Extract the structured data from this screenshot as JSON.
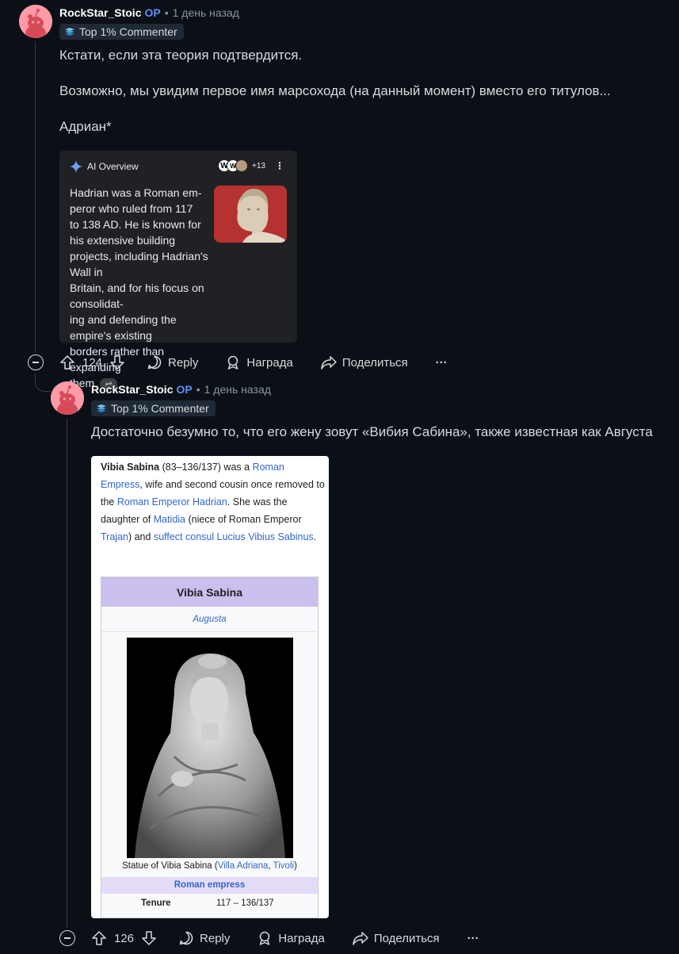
{
  "comments": [
    {
      "username": "RockStar_Stoic",
      "op_label": "OP",
      "separator": "•",
      "time": "1 день назад",
      "flair": "Top 1% Commenter",
      "body": [
        "Кстати, если эта теория подтвердится.",
        "Возможно, мы увидим первое имя марсохода (на данный момент) вместо его титулов...",
        "Адриан*"
      ],
      "attachment": {
        "type": "ai-overview",
        "header": "AI Overview",
        "source_count": "+13",
        "text": "Hadrian was a Roman em-\nperor who ruled from 117\nto 138 AD. He is known for\nhis extensive building\nprojects, including Hadrian's Wall in\nBritain, and for his focus on consolidat-\ning and defending the empire's existing\nborders rather than expanding\nthem."
      },
      "actions": {
        "score": "124",
        "reply": "Reply",
        "award": "Награда",
        "share": "Поделиться",
        "more": "···"
      }
    },
    {
      "username": "RockStar_Stoic",
      "op_label": "OP",
      "separator": "•",
      "time": "1 день назад",
      "flair": "Top 1% Commenter",
      "body": [
        "Достаточно безумно то, что его жену зовут «Вибия Сабина», также известная как Августа"
      ],
      "attachment": {
        "type": "wikipedia",
        "intro": {
          "name": "Vibia Sabina",
          "dates": " (83–136/137) was a ",
          "l1": "Roman Empress",
          "t2": ", wife and second cousin once removed to the ",
          "l2": "Roman Emperor Hadrian",
          "t3": ". She was the daughter of ",
          "l3": "Matidia",
          "t4": " (niece of Roman Emperor ",
          "l4": "Trajan",
          "t5": ") and ",
          "l5": "suffect consul Lucius Vibius Sabinus",
          "t6": "."
        },
        "infobox": {
          "title": "Vibia Sabina",
          "subtitle": "Augusta",
          "caption_prefix": "Statue of Vibia Sabina (",
          "caption_link1": "Villa Adriana",
          "caption_sep": ", ",
          "caption_link2": "Tivoli",
          "caption_suffix": ")",
          "section": "Roman empress",
          "row_key": "Tenure",
          "row_value": "117 – 136/137"
        }
      },
      "actions": {
        "score": "126",
        "reply": "Reply",
        "award": "Награда",
        "share": "Поделиться",
        "more": "···"
      }
    }
  ],
  "colors": {
    "background": "#0b1017",
    "op": "#5f8df6",
    "avatar": "#ff9aa8",
    "link": "#3366cc"
  }
}
